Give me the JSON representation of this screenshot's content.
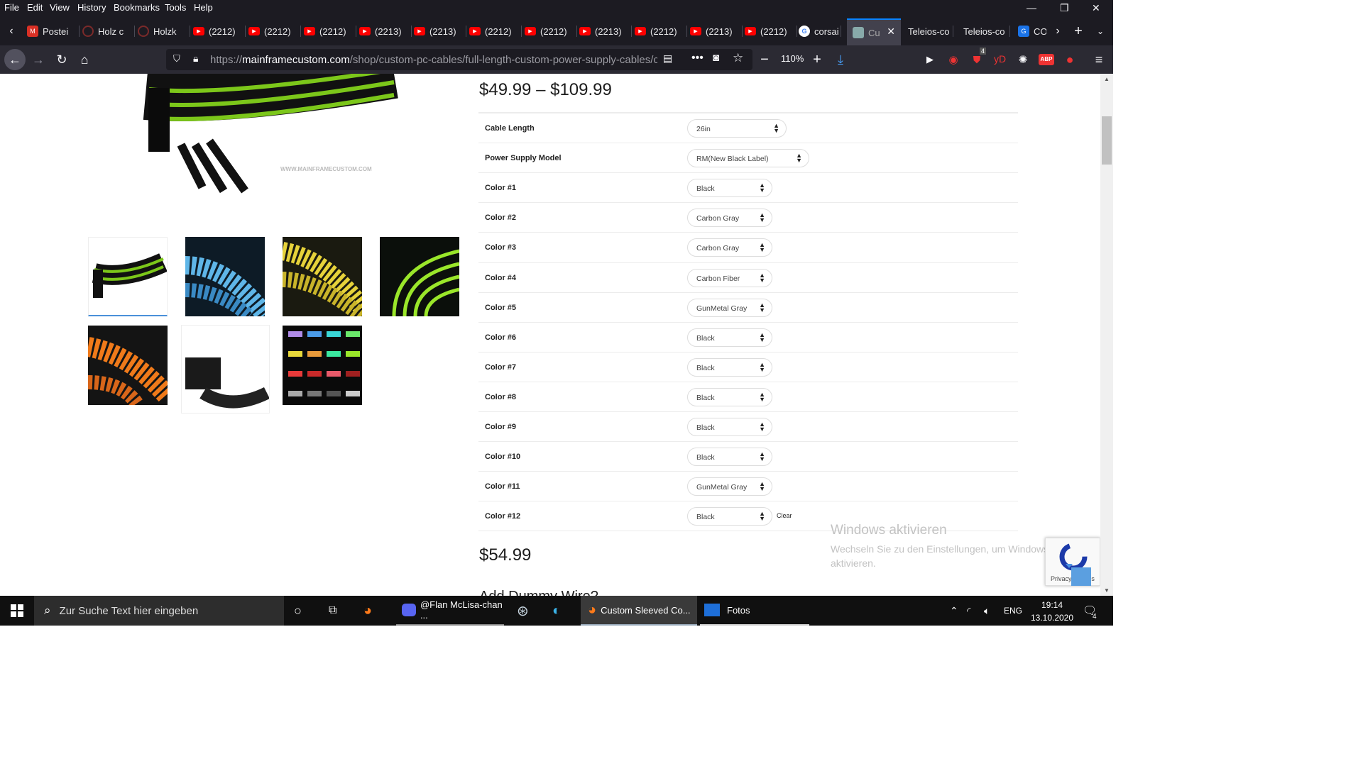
{
  "menu": [
    "File",
    "Edit",
    "View",
    "History",
    "Bookmarks",
    "Tools",
    "Help"
  ],
  "tabs": [
    {
      "label": "Postei",
      "icon": "gmail-icon",
      "color": "#d93025"
    },
    {
      "label": "Holz c",
      "icon": "site-icon",
      "color": "#7a2a2a"
    },
    {
      "label": "Holzk",
      "icon": "site-icon",
      "color": "#7a2a2a"
    },
    {
      "label": "(2212)",
      "icon": "youtube-icon",
      "color": "#ff0000"
    },
    {
      "label": "(2212)",
      "icon": "youtube-icon",
      "color": "#ff0000"
    },
    {
      "label": "(2212)",
      "icon": "youtube-icon",
      "color": "#ff0000"
    },
    {
      "label": "(2213)",
      "icon": "youtube-icon",
      "color": "#ff0000"
    },
    {
      "label": "(2213)",
      "icon": "youtube-icon",
      "color": "#ff0000"
    },
    {
      "label": "(2212)",
      "icon": "youtube-icon",
      "color": "#ff0000"
    },
    {
      "label": "(2212)",
      "icon": "youtube-icon",
      "color": "#ff0000"
    },
    {
      "label": "(2213)",
      "icon": "youtube-icon",
      "color": "#ff0000"
    },
    {
      "label": "(2212)",
      "icon": "youtube-icon",
      "color": "#ff0000"
    },
    {
      "label": "(2213)",
      "icon": "youtube-icon",
      "color": "#ff0000"
    },
    {
      "label": "(2212)",
      "icon": "youtube-icon",
      "color": "#ff0000"
    },
    {
      "label": "corsai",
      "icon": "google-icon",
      "color": "#ffffff"
    }
  ],
  "active_tab": {
    "label": "Cu"
  },
  "tabs_after": [
    {
      "label": "Teleios-co"
    },
    {
      "label": "Teleios-co"
    },
    {
      "label": "CO",
      "icon": "g-icon"
    }
  ],
  "url": {
    "prefix": "https://",
    "domain": "mainframecustom.com",
    "path": "/shop/custom-pc-cables/full-length-custom-power-supply-cables/cust"
  },
  "zoom": "110%",
  "toolbar_badge": "4",
  "product": {
    "watermark": "WWW.MAINFRAMECUSTOM.COM",
    "price_range": "$49.99 – $109.99",
    "options": [
      {
        "label": "Cable Length",
        "value": "26in"
      },
      {
        "label": "Power Supply Model",
        "value": "RM(New Black Label)"
      },
      {
        "label": "Color #1",
        "value": "Black"
      },
      {
        "label": "Color #2",
        "value": "Carbon Gray"
      },
      {
        "label": "Color #3",
        "value": "Carbon Gray"
      },
      {
        "label": "Color #4",
        "value": "Carbon Fiber"
      },
      {
        "label": "Color #5",
        "value": "GunMetal Gray"
      },
      {
        "label": "Color #6",
        "value": "Black"
      },
      {
        "label": "Color #7",
        "value": "Black"
      },
      {
        "label": "Color #8",
        "value": "Black"
      },
      {
        "label": "Color #9",
        "value": "Black"
      },
      {
        "label": "Color #10",
        "value": "Black"
      },
      {
        "label": "Color #11",
        "value": "GunMetal Gray"
      },
      {
        "label": "Color #12",
        "value": "Black"
      }
    ],
    "clear_label": "Clear",
    "total_price": "$54.99",
    "next_heading": "Add Dummy Wire?"
  },
  "activation": {
    "title": "Windows aktivieren",
    "body": "Wechseln Sie zu den Einstellungen, um Windows zu aktivieren."
  },
  "recaptcha": {
    "links": "Privacy - Terms"
  },
  "taskbar": {
    "search_placeholder": "Zur Suche Text hier eingeben",
    "discord": "@Flan McLisa-chan ...",
    "firefox": "Custom Sleeved Co...",
    "photos": "Fotos",
    "lang": "ENG",
    "time": "19:14",
    "date": "13.10.2020",
    "notif": "4"
  }
}
